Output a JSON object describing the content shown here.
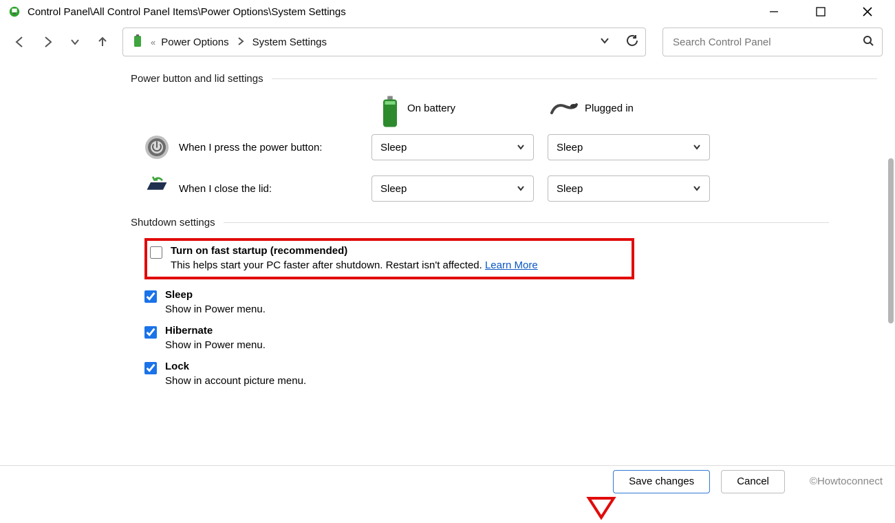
{
  "titlebar": {
    "title": "Control Panel\\All Control Panel Items\\Power Options\\System Settings"
  },
  "address": {
    "prefix_marker": "«",
    "part1": "Power Options",
    "part2": "System Settings"
  },
  "search": {
    "placeholder": "Search Control Panel"
  },
  "sections": {
    "power_lid": "Power button and lid settings",
    "shutdown": "Shutdown settings"
  },
  "columns": {
    "battery": "On battery",
    "plugged": "Plugged in"
  },
  "rows": {
    "power_button": {
      "label": "When I press the power button:",
      "battery_value": "Sleep",
      "plugged_value": "Sleep"
    },
    "lid": {
      "label": "When I close the lid:",
      "battery_value": "Sleep",
      "plugged_value": "Sleep"
    }
  },
  "shutdown": {
    "fast_startup": {
      "title": "Turn on fast startup (recommended)",
      "desc_prefix": "This helps start your PC faster after shutdown. Restart isn't affected. ",
      "learn": "Learn More"
    },
    "sleep": {
      "title": "Sleep",
      "desc": "Show in Power menu."
    },
    "hibernate": {
      "title": "Hibernate",
      "desc": "Show in Power menu."
    },
    "lock": {
      "title": "Lock",
      "desc": "Show in account picture menu."
    }
  },
  "footer": {
    "save": "Save changes",
    "cancel": "Cancel",
    "brand": "©Howtoconnect"
  }
}
